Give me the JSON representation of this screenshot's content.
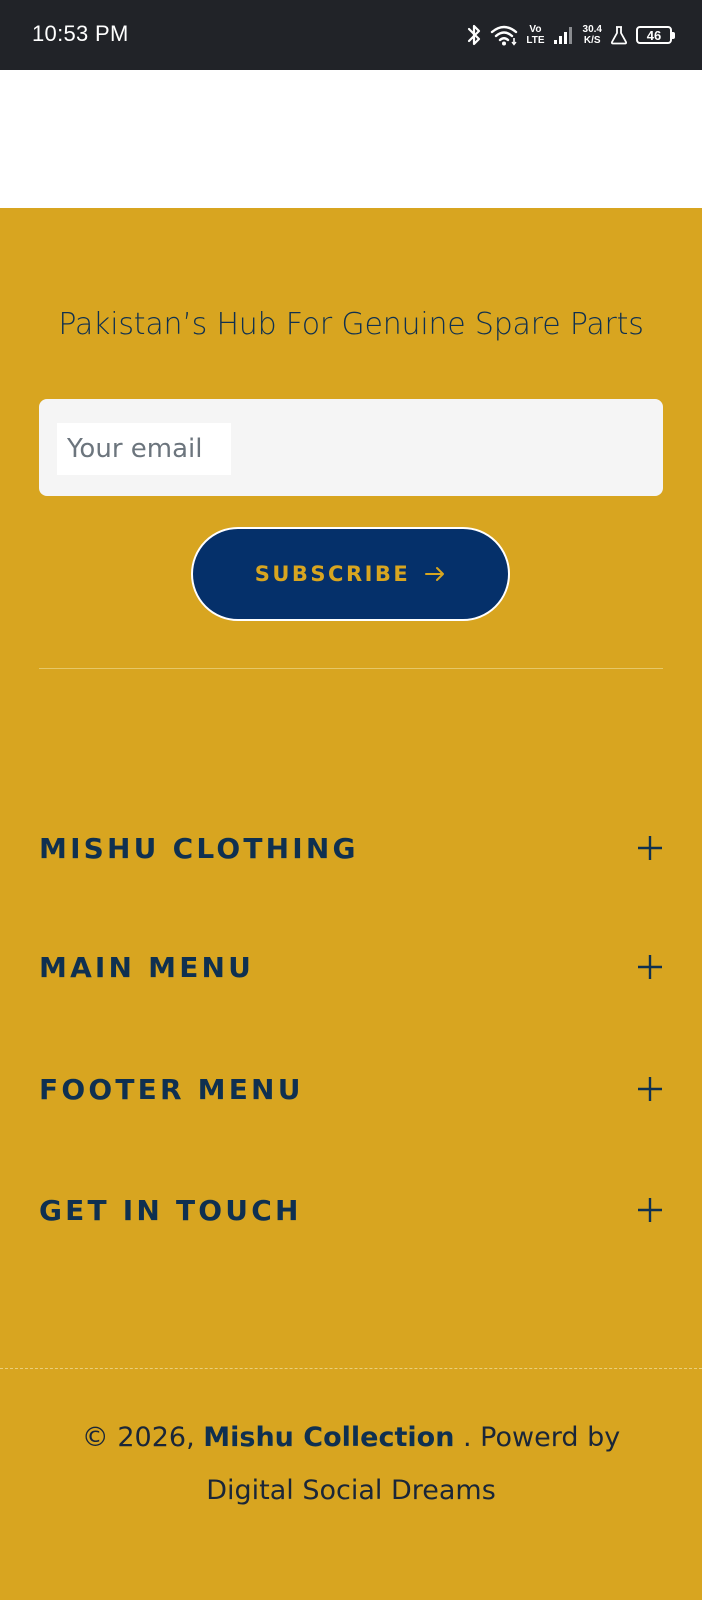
{
  "status_bar": {
    "time": "10:53 PM",
    "network_type_top": "Vo",
    "network_type_bottom": "LTE",
    "speed_value": "30.4",
    "speed_unit": "K/S",
    "battery": "46",
    "icons": [
      "bluetooth-icon",
      "wifi-icon",
      "volte-indicator",
      "cell-signal-icon",
      "speed-indicator",
      "lab-flask-icon",
      "battery-icon"
    ]
  },
  "footer": {
    "tagline": "Pakistan’s Hub For Genuine Spare Parts",
    "newsletter": {
      "email_placeholder": "Your email",
      "subscribe_label": "SUBSCRIBE",
      "subscribe_icon": "arrow-right-icon"
    },
    "accordions": [
      {
        "label": "MISHU CLOTHING",
        "icon": "plus-icon"
      },
      {
        "label": "MAIN MENU",
        "icon": "plus-icon"
      },
      {
        "label": "FOOTER MENU",
        "icon": "plus-icon"
      },
      {
        "label": "GET IN TOUCH",
        "icon": "plus-icon"
      }
    ],
    "copyright": {
      "prefix": "© 2026, ",
      "brand": "Mishu Collection",
      "separator": " . Powerd by",
      "credit": "Digital Social Dreams"
    }
  },
  "colors": {
    "status_bar_bg": "#212328",
    "footer_bg": "#d8a520",
    "navy": "#0f3050",
    "button_bg": "#05306a",
    "input_bg": "#f5f5f5"
  }
}
